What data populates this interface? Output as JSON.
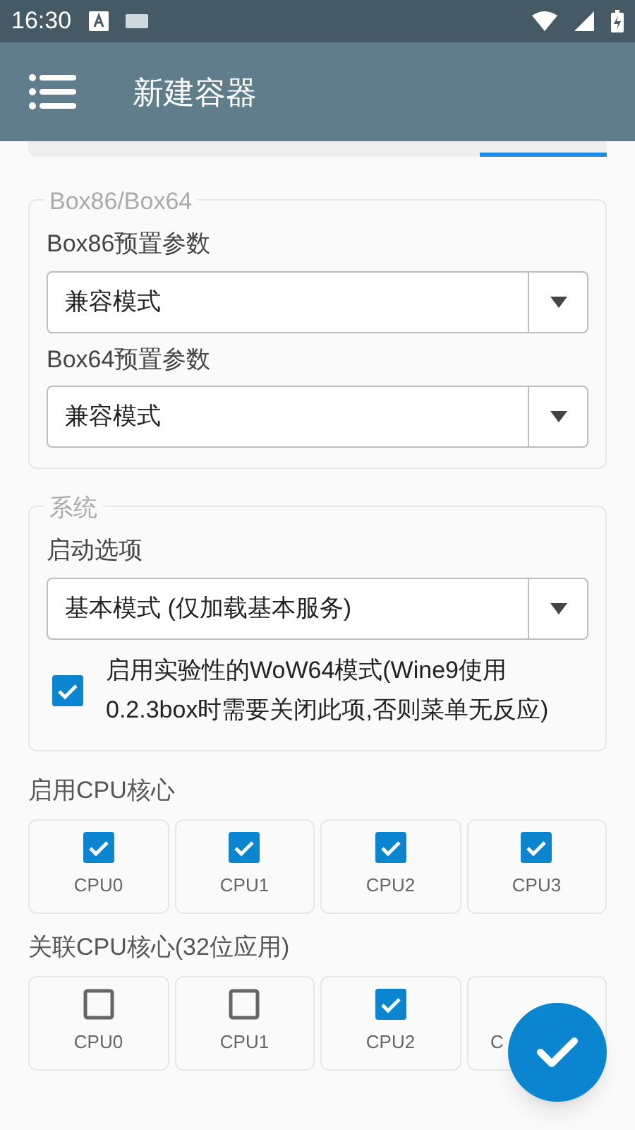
{
  "status_bar": {
    "time": "16:30"
  },
  "app_bar": {
    "title": "新建容器"
  },
  "tab_strip": {
    "kind": "underline"
  },
  "sections": [
    {
      "legend": "Box86/Box64",
      "fields": [
        {
          "label": "Box86预置参数",
          "value": "兼容模式"
        },
        {
          "label": "Box64预置参数",
          "value": "兼容模式"
        }
      ]
    },
    {
      "legend": "系统",
      "fields": [
        {
          "label": "启动选项",
          "value": "基本模式 (仅加载基本服务)"
        }
      ],
      "checkbox": {
        "label": "启用实验性的WoW64模式(Wine9使用0.2.3box时需要关闭此项,否则菜单无反应)",
        "checked": true
      }
    }
  ],
  "cpu_groups": [
    {
      "title": "启用CPU核心",
      "cpus": [
        {
          "label": "CPU0",
          "checked": true
        },
        {
          "label": "CPU1",
          "checked": true
        },
        {
          "label": "CPU2",
          "checked": true
        },
        {
          "label": "CPU3",
          "checked": true
        }
      ]
    },
    {
      "title": "关联CPU核心(32位应用)",
      "cpus": [
        {
          "label": "CPU0",
          "checked": false
        },
        {
          "label": "CPU1",
          "checked": false
        },
        {
          "label": "CPU2",
          "checked": true
        },
        {
          "label": "C"
        }
      ]
    }
  ]
}
